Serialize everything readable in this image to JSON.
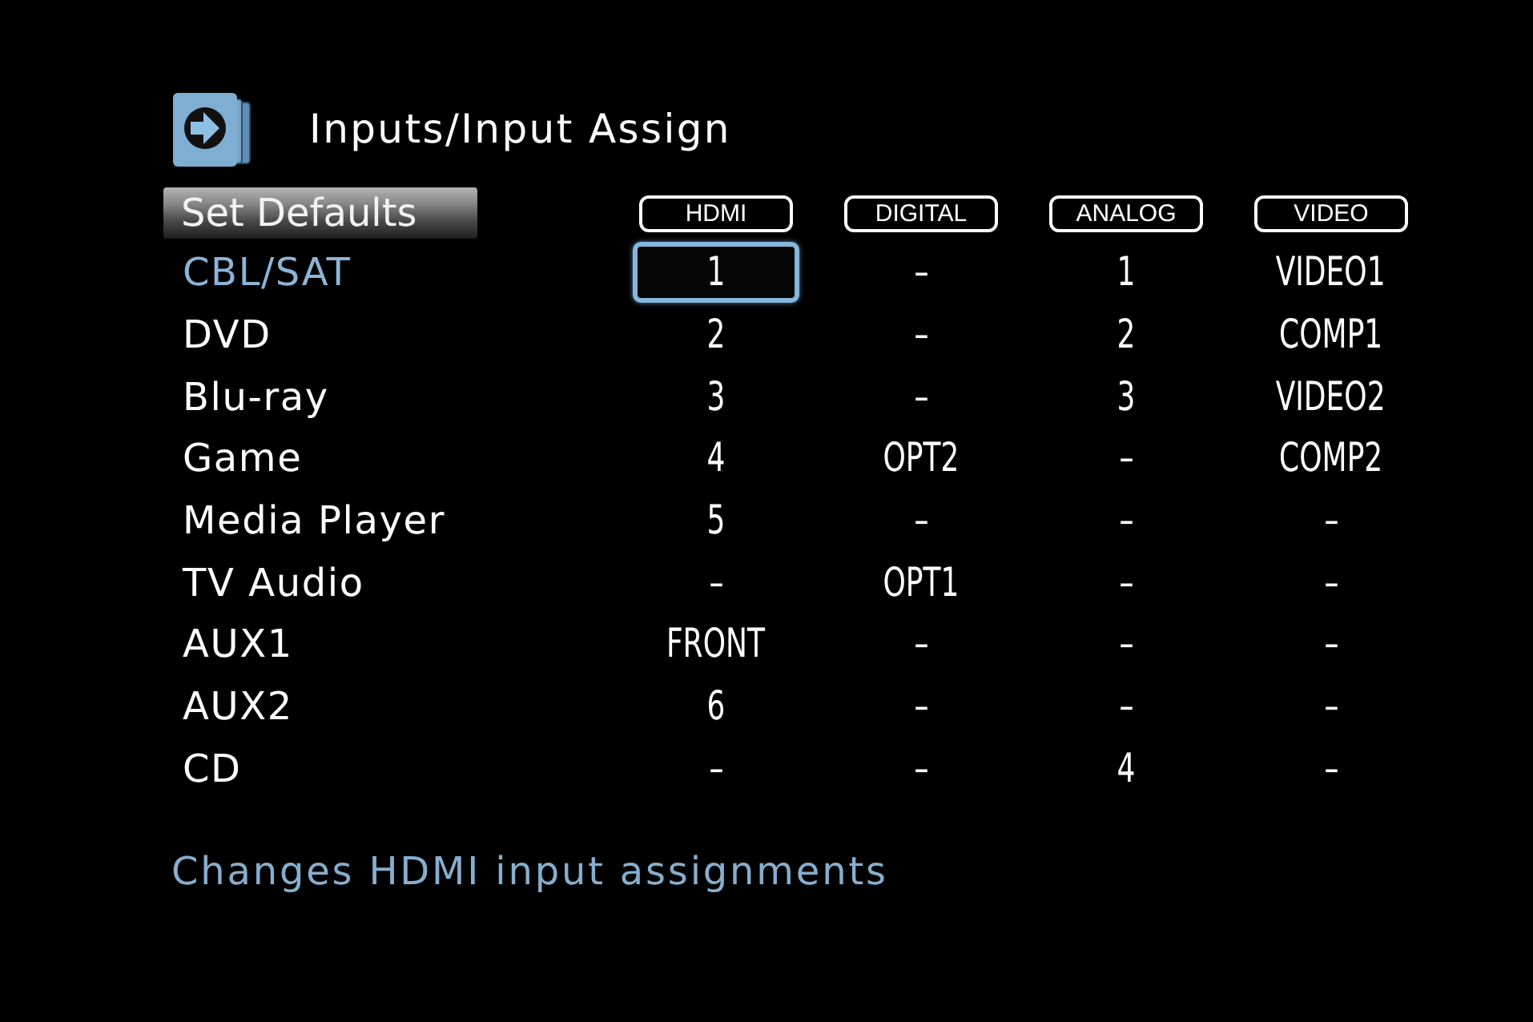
{
  "title": {
    "text": "Inputs/Input Assign"
  },
  "set_defaults": {
    "label": "Set Defaults"
  },
  "table": {
    "columns": [
      "HDMI",
      "DIGITAL",
      "ANALOG",
      "VIDEO"
    ],
    "rows": [
      {
        "source": "CBL/SAT",
        "selected": true,
        "cells": [
          {
            "text": "1",
            "selected": true
          },
          {
            "text": "–",
            "selected": false
          },
          {
            "text": "1",
            "selected": false
          },
          {
            "text": "VIDEO1",
            "selected": false
          }
        ]
      },
      {
        "source": "DVD",
        "selected": false,
        "cells": [
          {
            "text": "2",
            "selected": false
          },
          {
            "text": "–",
            "selected": false
          },
          {
            "text": "2",
            "selected": false
          },
          {
            "text": "COMP1",
            "selected": false
          }
        ]
      },
      {
        "source": "Blu-ray",
        "selected": false,
        "cells": [
          {
            "text": "3",
            "selected": false
          },
          {
            "text": "–",
            "selected": false
          },
          {
            "text": "3",
            "selected": false
          },
          {
            "text": "VIDEO2",
            "selected": false
          }
        ]
      },
      {
        "source": "Game",
        "selected": false,
        "cells": [
          {
            "text": "4",
            "selected": false
          },
          {
            "text": "OPT2",
            "selected": false
          },
          {
            "text": "–",
            "selected": false
          },
          {
            "text": "COMP2",
            "selected": false
          }
        ]
      },
      {
        "source": "Media Player",
        "selected": false,
        "cells": [
          {
            "text": "5",
            "selected": false
          },
          {
            "text": "–",
            "selected": false
          },
          {
            "text": "–",
            "selected": false
          },
          {
            "text": "–",
            "selected": false
          }
        ]
      },
      {
        "source": "TV Audio",
        "selected": false,
        "cells": [
          {
            "text": "–",
            "selected": false
          },
          {
            "text": "OPT1",
            "selected": false
          },
          {
            "text": "–",
            "selected": false
          },
          {
            "text": "–",
            "selected": false
          }
        ]
      },
      {
        "source": "AUX1",
        "selected": false,
        "cells": [
          {
            "text": "FRONT",
            "selected": false
          },
          {
            "text": "–",
            "selected": false
          },
          {
            "text": "–",
            "selected": false
          },
          {
            "text": "–",
            "selected": false
          }
        ]
      },
      {
        "source": "AUX2",
        "selected": false,
        "cells": [
          {
            "text": "6",
            "selected": false
          },
          {
            "text": "–",
            "selected": false
          },
          {
            "text": "–",
            "selected": false
          },
          {
            "text": "–",
            "selected": false
          }
        ]
      },
      {
        "source": "CD",
        "selected": false,
        "cells": [
          {
            "text": "–",
            "selected": false
          },
          {
            "text": "–",
            "selected": false
          },
          {
            "text": "4",
            "selected": false
          },
          {
            "text": "–",
            "selected": false
          }
        ]
      }
    ]
  },
  "help_text": "Changes HDMI input assignments"
}
